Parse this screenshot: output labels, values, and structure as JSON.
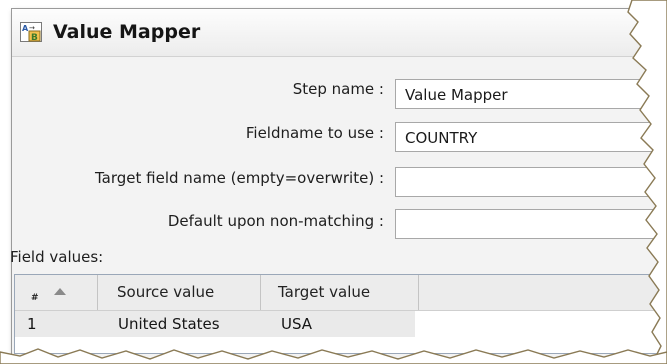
{
  "window": {
    "title": "Value Mapper",
    "icon": "value-mapper-icon"
  },
  "fields": {
    "step_name": {
      "label": "Step name :",
      "value": "Value Mapper"
    },
    "fieldname": {
      "label": "Fieldname to use :",
      "value": "COUNTRY"
    },
    "target_field": {
      "label": "Target field name (empty=overwrite) :",
      "value": ""
    },
    "default_nonmatch": {
      "label": "Default upon non-matching :",
      "value": ""
    }
  },
  "field_values": {
    "label": "Field values:",
    "columns": [
      "#",
      "Source value",
      "Target value"
    ],
    "rows": [
      {
        "num": "1",
        "source": "United States",
        "target": "USA"
      }
    ]
  },
  "colors": {
    "window_bg": "#f3f3f3",
    "header_bg": "#ececec",
    "selected_row": "#eaeaea"
  }
}
